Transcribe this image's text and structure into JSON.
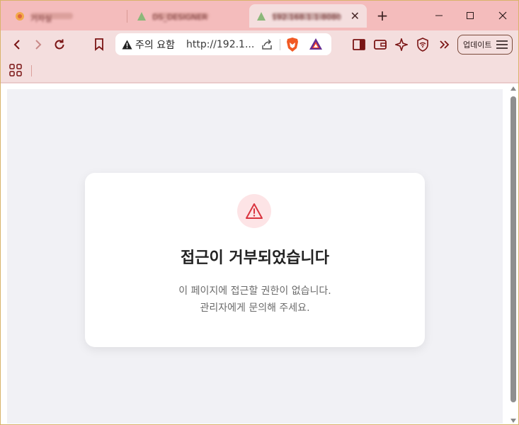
{
  "tabs": [
    {
      "title": "기자실"
    },
    {
      "title": "DS_DESIGNER"
    },
    {
      "title": "192.168.1.1:8080",
      "active": true
    }
  ],
  "toolbar": {
    "security_warning": "주의 요함",
    "url": "http://192.1...",
    "update_label": "업데이트"
  },
  "error_card": {
    "title": "접근이 거부되었습니다",
    "message_line1": "이 페이지에 접근할 권한이 없습니다.",
    "message_line2": "관리자에게 문의해 주세요."
  },
  "colors": {
    "tab_strip": "#f4bcbc",
    "toolbar": "#f4dede",
    "accent": "#7a1414",
    "alert_bg": "#fde4e6",
    "alert_icon": "#d9343f",
    "page_bg": "#f1f1f5"
  }
}
